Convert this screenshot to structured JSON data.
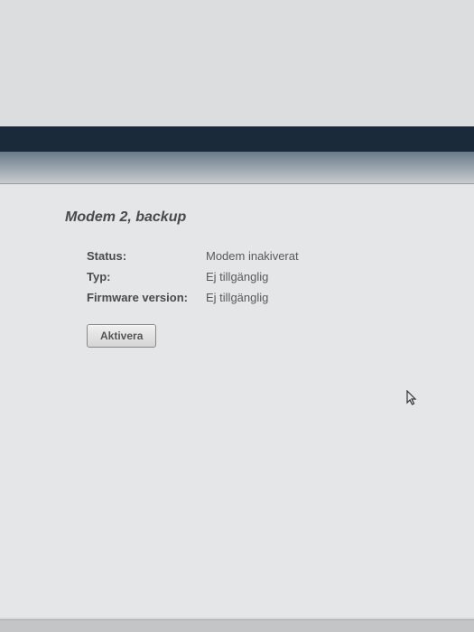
{
  "section": {
    "title": "Modem 2, backup"
  },
  "fields": {
    "status_label": "Status:",
    "status_value": "Modem inakiverat",
    "type_label": "Typ:",
    "type_value": "Ej tillgänglig",
    "firmware_label": "Firmware version:",
    "firmware_value": "Ej tillgänglig"
  },
  "buttons": {
    "activate": "Aktivera"
  }
}
